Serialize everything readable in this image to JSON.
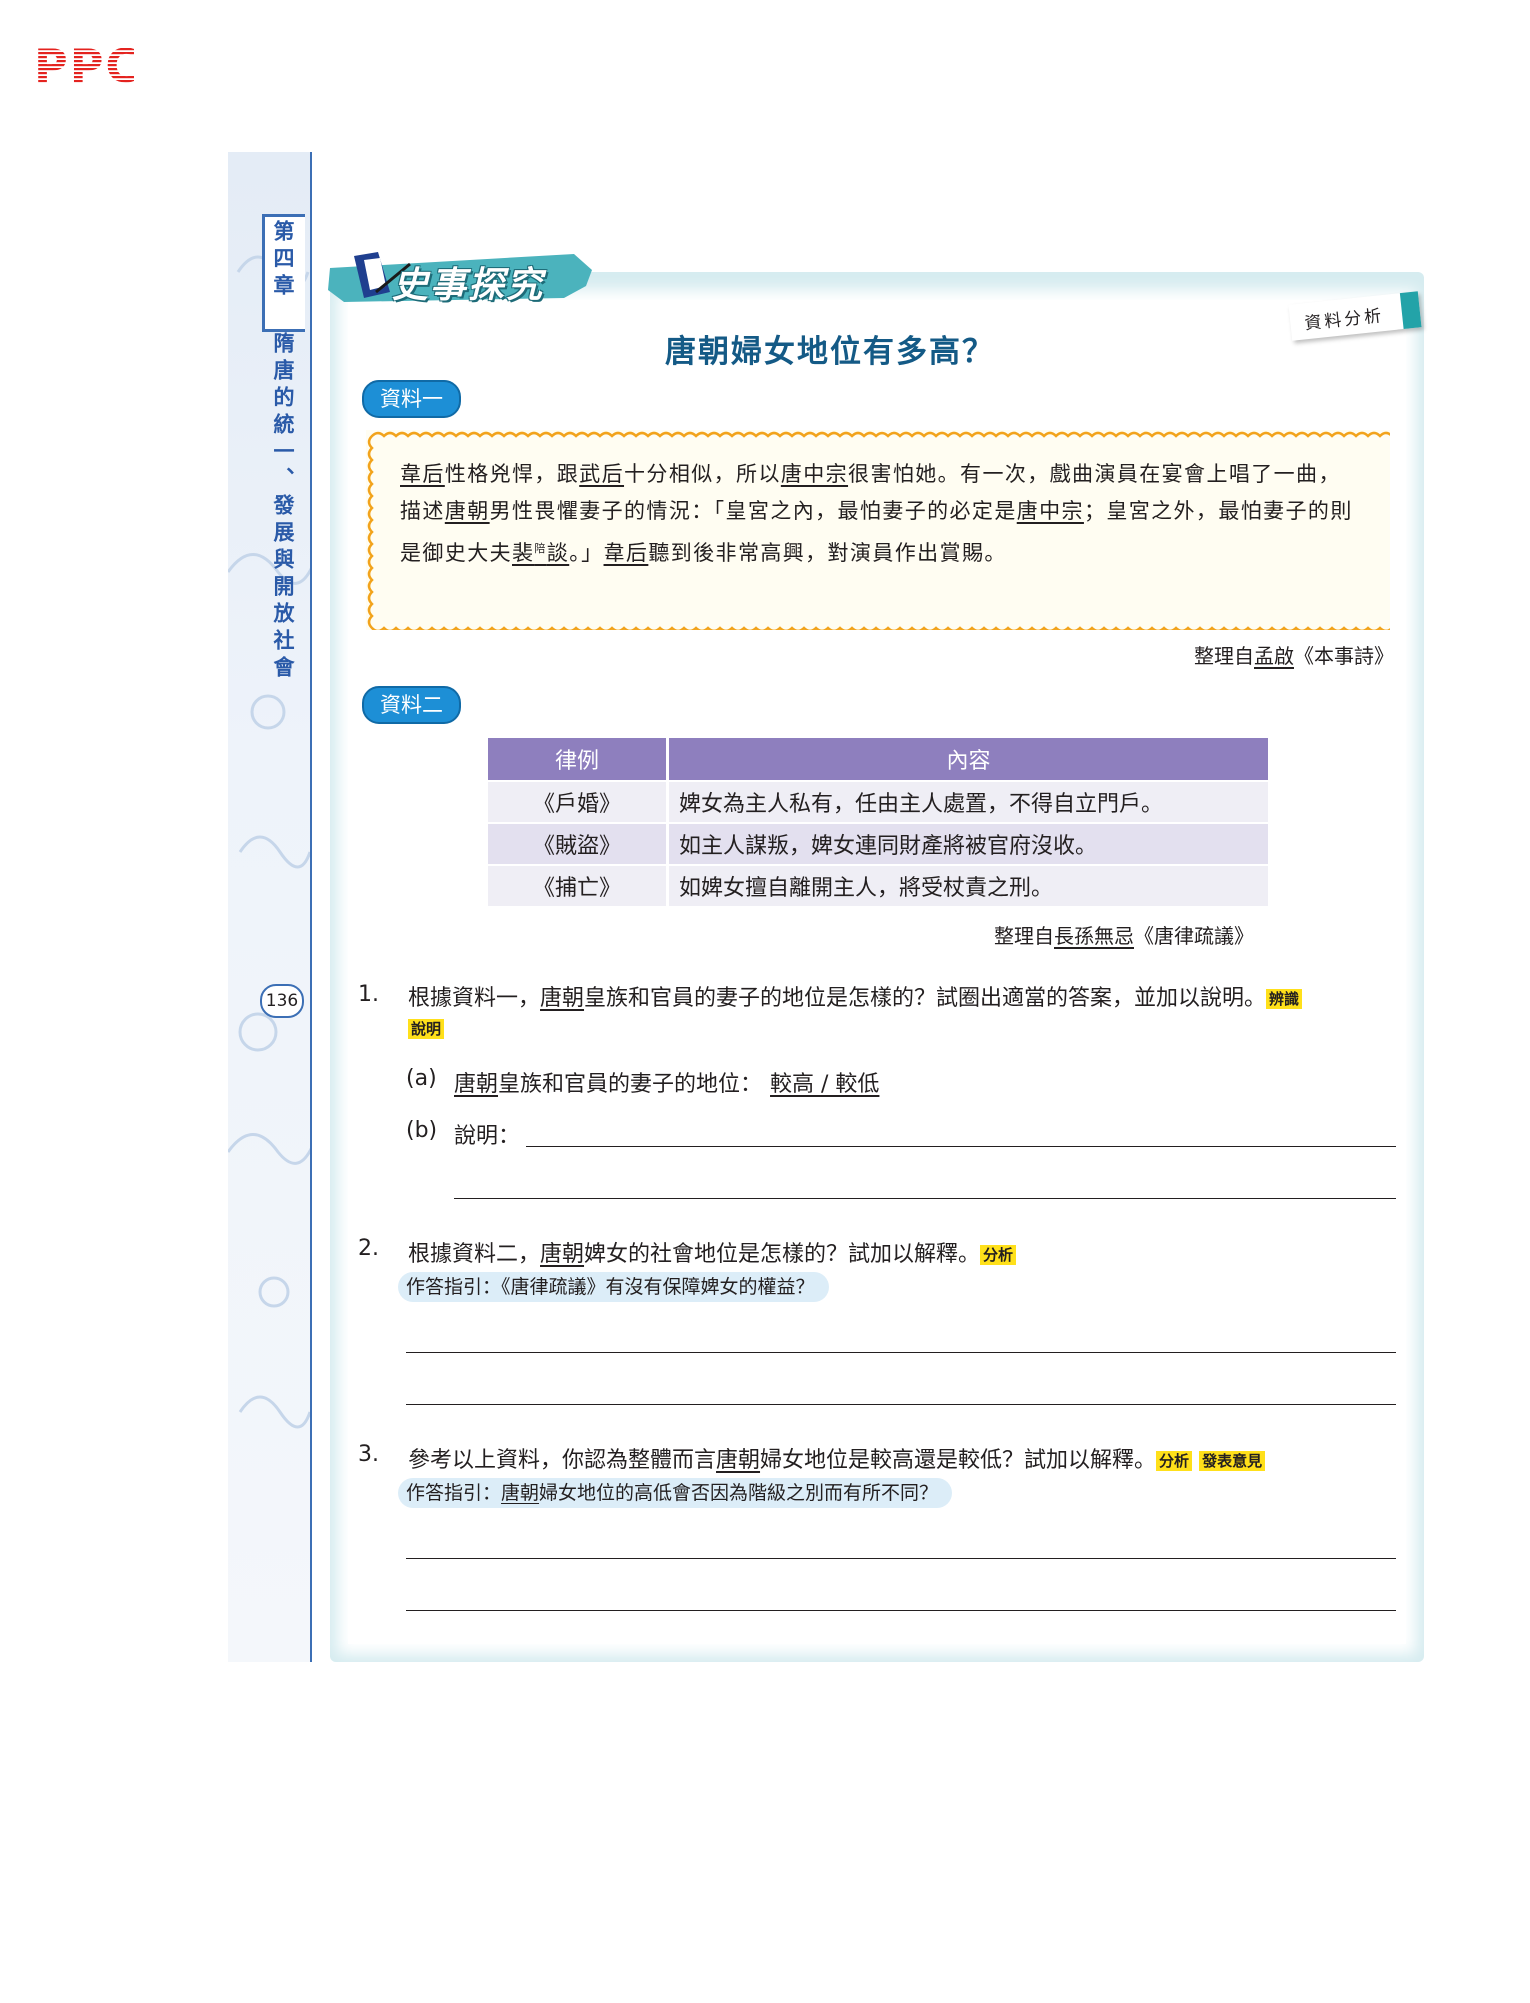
{
  "header": {
    "logo_text": "PPC"
  },
  "sidebar": {
    "chapter_label": "第四章",
    "chapter_title": "隋唐的統一、發展與開放社會",
    "page_number": "136"
  },
  "section": {
    "banner": "史事探究",
    "tag": "資料分析",
    "title": "唐朝婦女地位有多高？"
  },
  "source1": {
    "label": "資料一",
    "parts": {
      "a1": "韋后",
      "a2": "性格兇悍，跟",
      "a3": "武后",
      "a4": "十分相似，所以",
      "a5": "唐中宗",
      "a6": "很害怕她。有一次，戲曲演員在宴會上唱了一曲，描述",
      "a7": "唐朝",
      "a8": "男性畏懼妻子的情況：「皇宮之內，最怕妻子的必定是",
      "a9": "唐中宗",
      "a10": "；皇宮之外，最怕妻子的則是御史大夫",
      "a11": "裴",
      "ruby": "陪",
      "a12": "談",
      "a13": "。」",
      "a14": "韋后",
      "a15": "聽到後非常高興，對演員作出賞賜。"
    },
    "citation_prefix": "整理自",
    "citation_author": "孟啟",
    "citation_work": "《本事詩》"
  },
  "source2": {
    "label": "資料二",
    "table": {
      "headers": [
        "律例",
        "內容"
      ],
      "rows": [
        [
          "《戶婚》",
          "婢女為主人私有，任由主人處置，不得自立門戶。"
        ],
        [
          "《賊盜》",
          "如主人謀叛，婢女連同財產將被官府沒收。"
        ],
        [
          "《捕亡》",
          "如婢女擅自離開主人，將受杖責之刑。"
        ]
      ]
    },
    "citation_prefix": "整理自",
    "citation_author": "長孫無忌",
    "citation_work": "《唐律疏議》"
  },
  "questions": {
    "q1": {
      "number": "1.",
      "pre": "根據資料一，",
      "dynasty": "唐朝",
      "post": "皇族和官員的妻子的地位是怎樣的？試圈出適當的答案，並加以說明。",
      "skill": "辨識說明",
      "skill_a": "辨識",
      "skill_b": "說明",
      "a_label": "(a)",
      "a_dynasty": "唐朝",
      "a_text": "皇族和官員的妻子的地位：",
      "a_answer": "較高 / 較低",
      "b_label": "(b)",
      "b_text": "說明："
    },
    "q2": {
      "number": "2.",
      "pre": "根據資料二，",
      "dynasty": "唐朝",
      "post": "婢女的社會地位是怎樣的？試加以解釋。",
      "skill": "分析",
      "hint": "作答指引：《唐律疏議》有沒有保障婢女的權益？"
    },
    "q3": {
      "number": "3.",
      "pre": "參考以上資料，你認為整體而言",
      "dynasty": "唐朝",
      "post": "婦女地位是較高還是較低？試加以解釋。",
      "skill1": "分析",
      "skill2": "發表意見",
      "hint_pre": "作答指引：",
      "hint_dynasty": "唐朝",
      "hint_post": "婦女地位的高低會否因為階級之別而有所不同？"
    }
  },
  "colors": {
    "accent_blue": "#1d8fd6",
    "title_blue": "#145a86",
    "table_header": "#8e7fbe",
    "frame_teal": "#d6ecf0",
    "skill_yellow": "#ffe01a",
    "logo_red": "#e4231f"
  }
}
